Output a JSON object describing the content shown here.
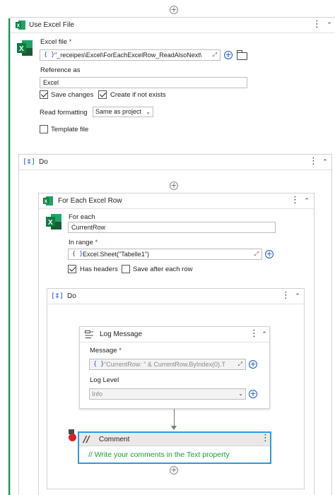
{
  "use_excel_file": {
    "title": "Use Excel File",
    "excel_file_label": "Excel file",
    "required_mark": "*",
    "excel_file_value": "\"_receipes\\Excel\\ForEachExcelRow_ReadAlsoNext\\",
    "reference_label": "Reference as",
    "reference_value": "Excel",
    "save_changes_label": "Save changes",
    "save_changes_checked": true,
    "create_if_not_exists_label": "Create if not exists",
    "create_if_not_exists_checked": true,
    "read_formatting_label": "Read formatting",
    "read_formatting_value": "Same as project",
    "template_file_label": "Template file",
    "template_file_checked": false
  },
  "outer_do": {
    "title": "Do"
  },
  "for_each_row": {
    "title": "For Each Excel Row",
    "for_each_label": "For each",
    "for_each_value": "CurrentRow",
    "in_range_label": "In range",
    "required_mark": "*",
    "in_range_value": "Excel.Sheet(\"Tabelle1\")",
    "has_headers_label": "Has headers",
    "has_headers_checked": true,
    "save_after_each_row_label": "Save after each row",
    "save_after_each_row_checked": false
  },
  "inner_do": {
    "title": "Do"
  },
  "log_message": {
    "title": "Log Message",
    "message_label": "Message",
    "required_mark": "*",
    "message_value": "\"CurrentRow: \" & CurrentRow.ByIndex(0).T",
    "log_level_label": "Log Level",
    "log_level_value": "Info"
  },
  "comment": {
    "title": "Comment",
    "text": "// Write your comments in the Text property"
  },
  "glyphs": {
    "add": "+",
    "kebab": "⋮",
    "collapse": "⌃",
    "expand": "⤢",
    "brace": "{ }",
    "do_brace": "[‡]",
    "caret": "⌄",
    "comment_slashes": "//"
  },
  "colors": {
    "accent_blue": "#1a56c8",
    "excel_green": "#1e7145",
    "selection_blue": "#2b9be0",
    "comment_green": "#1e9a3a",
    "breakpoint_red": "#d9202b"
  }
}
